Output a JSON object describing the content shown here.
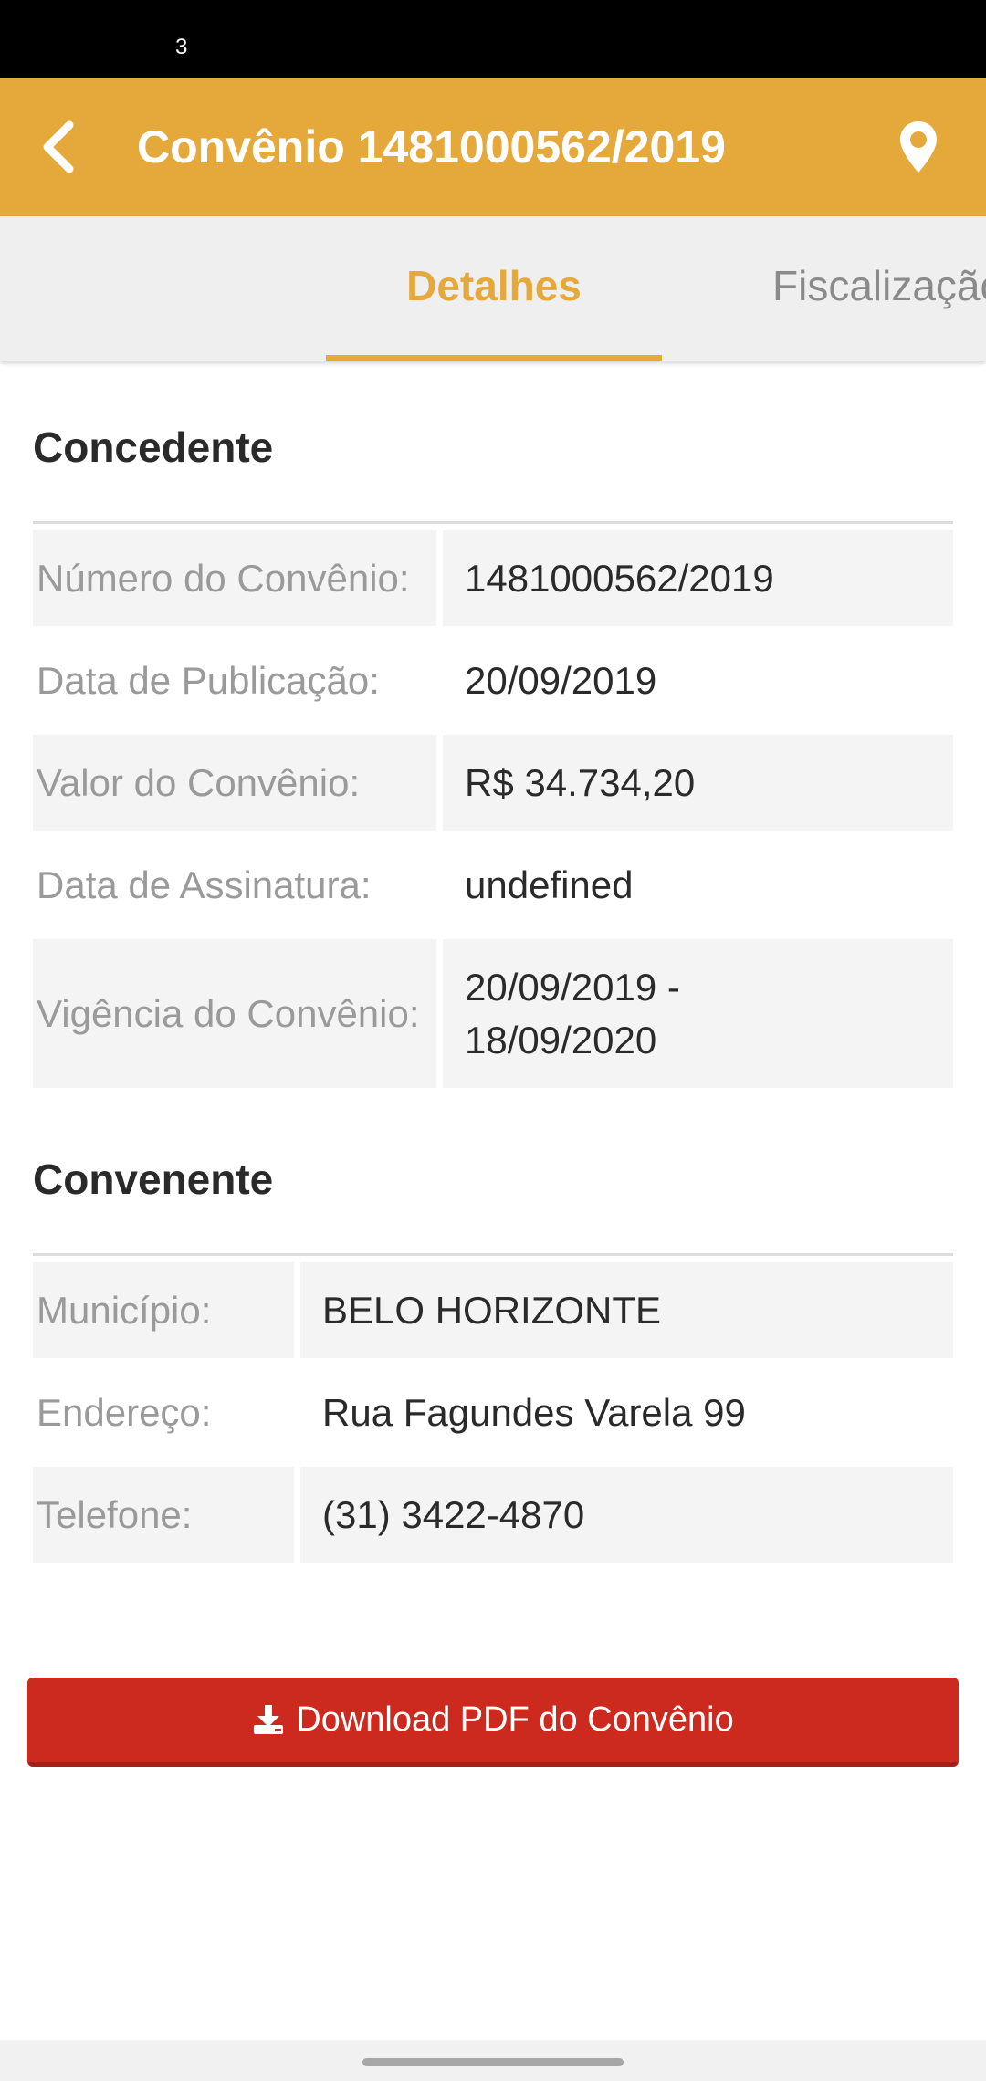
{
  "status_bar": {
    "notification_count": "3"
  },
  "header": {
    "title": "Convênio 1481000562/2019",
    "back_icon": "chevron-left-icon",
    "location_icon": "map-pin-icon",
    "color": "#e5a83a"
  },
  "tabs": [
    {
      "label": "Detalhes",
      "active": true
    },
    {
      "label": "Fiscalização",
      "active": false
    }
  ],
  "concedente": {
    "title": "Concedente",
    "rows": [
      {
        "label": "Número do Convênio:",
        "value": "1481000562/2019"
      },
      {
        "label": "Data de Publicação:",
        "value": "20/09/2019"
      },
      {
        "label": "Valor do Convênio:",
        "value": "R$ 34.734,20"
      },
      {
        "label": "Data de Assinatura:",
        "value": "undefined"
      },
      {
        "label": "Vigência do Convênio:",
        "value": "20/09/2019 - 18/09/2020"
      }
    ]
  },
  "convenente": {
    "title": "Convenente",
    "rows": [
      {
        "label": "Município:",
        "value": "BELO HORIZONTE"
      },
      {
        "label": "Endereço:",
        "value": "Rua Fagundes Varela 99"
      },
      {
        "label": "Telefone:",
        "value": "(31) 3422-4870"
      }
    ]
  },
  "download": {
    "label": "Download PDF do Convênio",
    "icon": "download-icon",
    "color": "#cc2a1f"
  }
}
